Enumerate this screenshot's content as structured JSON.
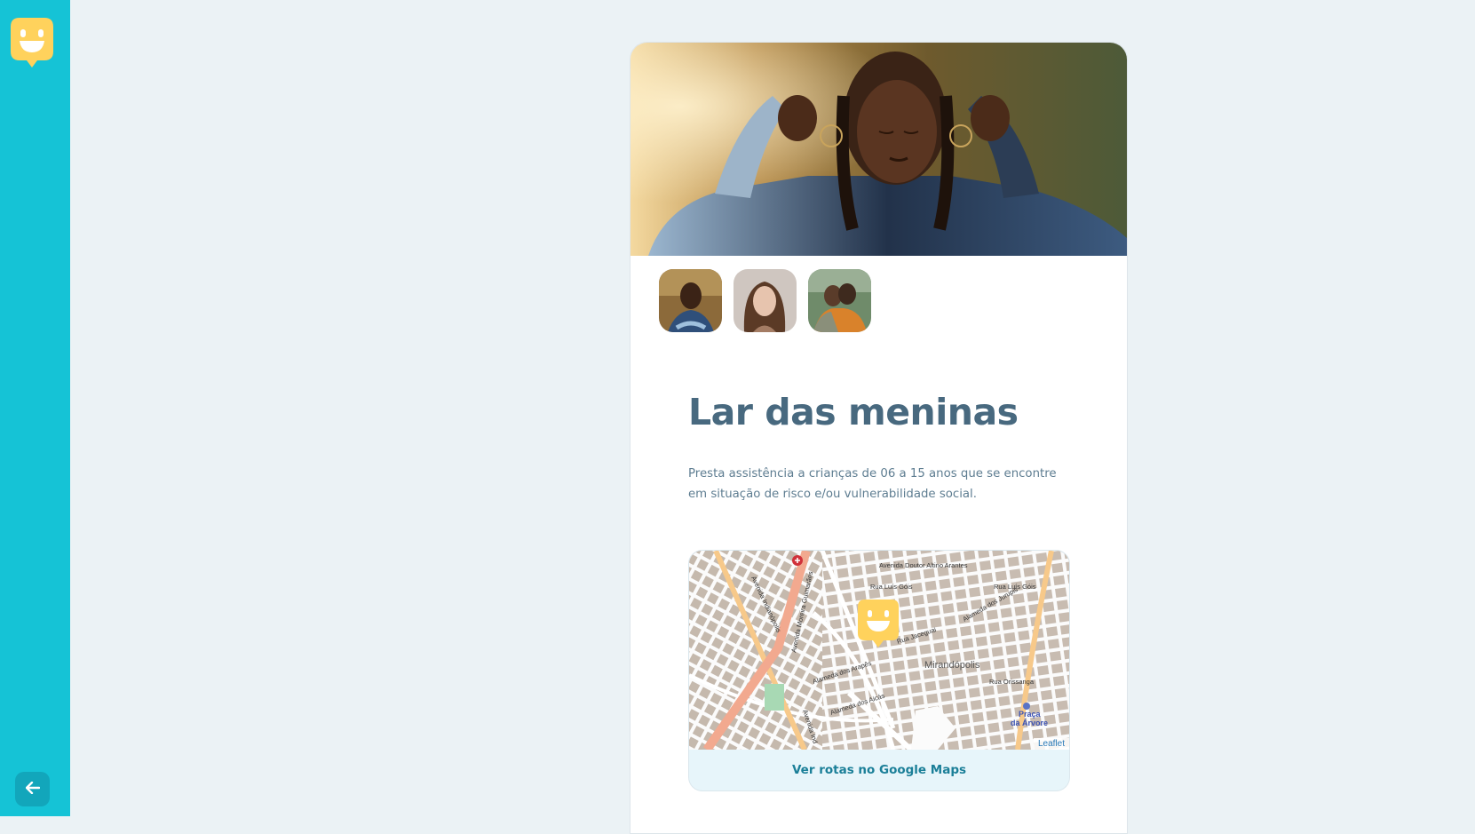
{
  "sidebar": {
    "logo_icon": "smiley-chat-logo-icon",
    "back_icon": "arrow-left-icon"
  },
  "place": {
    "name": "Lar das meninas",
    "description": "Presta assistência a crianças de 06 a 15 anos que se encontre em situação de risco e/ou vulnerabilidade social."
  },
  "gallery": {
    "thumbnails": [
      "photo-1",
      "photo-2",
      "photo-3"
    ],
    "selected_index": 0
  },
  "map": {
    "labels": {
      "avenida_altino": "Avenida Doutor Altino Arantes",
      "rua_luis_gois_1": "Rua Luís Góis",
      "rua_luis_gois_2": "Rua Luís Góis",
      "av_moreira": "Avenida Moreira Guimarães",
      "av_indianopolis": "Avenida Indianópolis",
      "av_indianopolis_2": "Avenida Ind",
      "mirandopolis": "Mirandópolis",
      "praca_1": "Praça",
      "praca_2": "da Árvore",
      "rua_orissanga": "Rua Orissanga",
      "al_araes": "Alameda dos Arapês",
      "al_aicas": "Alameda dos Aicás",
      "al_jurupis": "Alameda dos Jurupis",
      "rua_jaceguai": "Rua Jaceguai"
    },
    "attribution": "Leaflet",
    "routes_link": "Ver rotas no Google Maps",
    "colors": {
      "marker": "#ffd25c",
      "major_road": "#f2a98f",
      "secondary_road": "#f7c98a"
    }
  },
  "colors": {
    "sidebar": "#15c3d6",
    "accent": "#1b7f98",
    "title": "#48697f",
    "background": "#ebf2f5"
  }
}
